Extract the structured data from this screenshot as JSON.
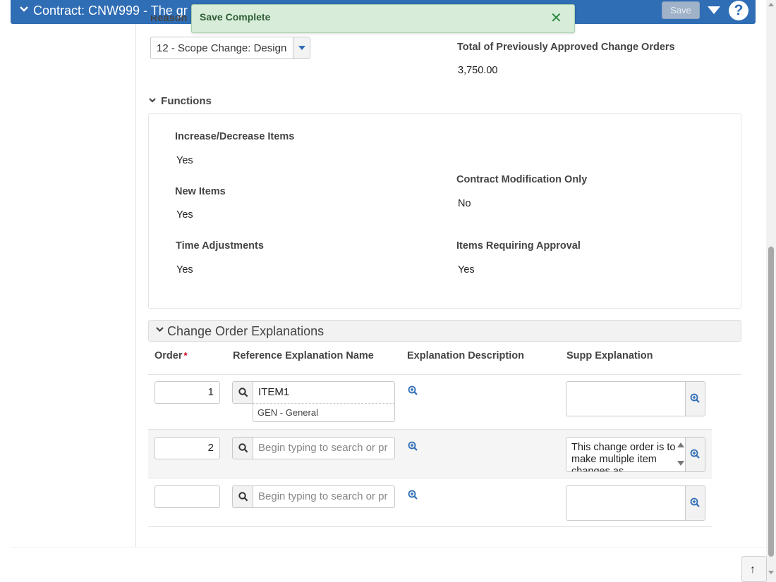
{
  "header": {
    "title": "Contract: CNW999 - The gr",
    "save_label": "Save",
    "help_glyph": "?",
    "accent_color": "#2f6db5"
  },
  "toast": {
    "message": "Save Complete",
    "close_glyph": "✕"
  },
  "summary": {
    "reason_label": "Reason",
    "reason_value": "12 - Scope Change: Design",
    "prev_total_label": "Total of Previously Approved Change Orders",
    "prev_total_value": "3,750.00"
  },
  "functions": {
    "heading": "Functions",
    "fields": [
      {
        "label": "Increase/Decrease Items",
        "value": "Yes"
      },
      {
        "label": "New Items",
        "value": "Yes"
      },
      {
        "label": "Contract Modification Only",
        "value": "No"
      },
      {
        "label": "Time Adjustments",
        "value": "Yes"
      },
      {
        "label": "Items Requiring Approval",
        "value": "Yes"
      }
    ]
  },
  "explanations": {
    "heading": "Change Order Explanations",
    "columns": {
      "order": "Order",
      "required_marker": "*",
      "ref_name": "Reference Explanation Name",
      "description": "Explanation Description",
      "supp": "Supp Explanation"
    },
    "rows": [
      {
        "order": "1",
        "ref_value": "ITEM1",
        "ref_sub": "GEN - General",
        "ref_placeholder": "",
        "supp": ""
      },
      {
        "order": "2",
        "ref_value": "",
        "ref_sub": "",
        "ref_placeholder": "Begin typing to search or pr",
        "supp": "This change order is to make multiple item changes as"
      },
      {
        "order": "",
        "ref_value": "",
        "ref_sub": "",
        "ref_placeholder": "Begin typing to search or pr",
        "supp": ""
      }
    ]
  },
  "scroll_top_glyph": "↑"
}
